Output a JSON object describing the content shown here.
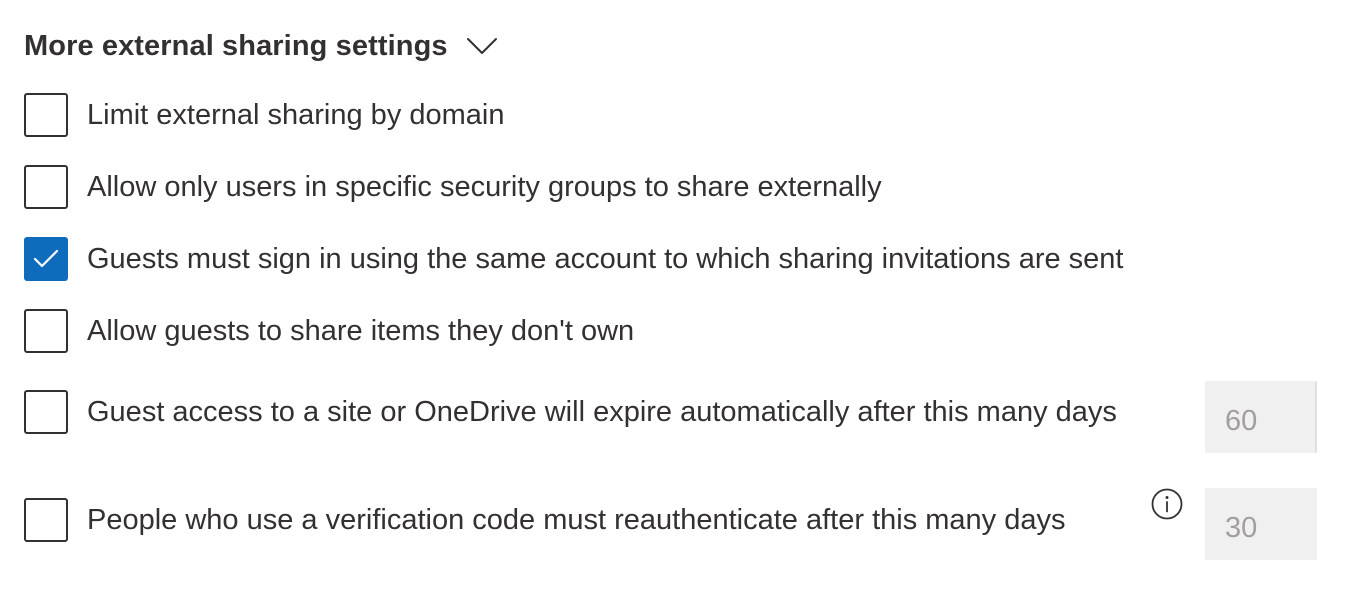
{
  "section": {
    "title": "More external sharing settings",
    "chevron_icon": "chevron-down-icon"
  },
  "options": [
    {
      "label": "Limit external sharing by domain",
      "checked": false
    },
    {
      "label": "Allow only users in specific security groups to share externally",
      "checked": false
    },
    {
      "label": "Guests must sign in using the same account to which sharing invitations are sent",
      "checked": true
    },
    {
      "label": "Allow guests to share items they don't own",
      "checked": false
    },
    {
      "label": "Guest access to a site or OneDrive will expire automatically after this many days",
      "checked": false,
      "input_value": "60"
    },
    {
      "label": "People who use a verification code must reauthenticate after this many days",
      "checked": false,
      "input_value": "30",
      "info_icon": "info-icon"
    }
  ],
  "colors": {
    "accent": "#0f6cbd",
    "text": "#323130",
    "input_bg": "#f0f0f0",
    "input_text": "#a19f9d"
  }
}
